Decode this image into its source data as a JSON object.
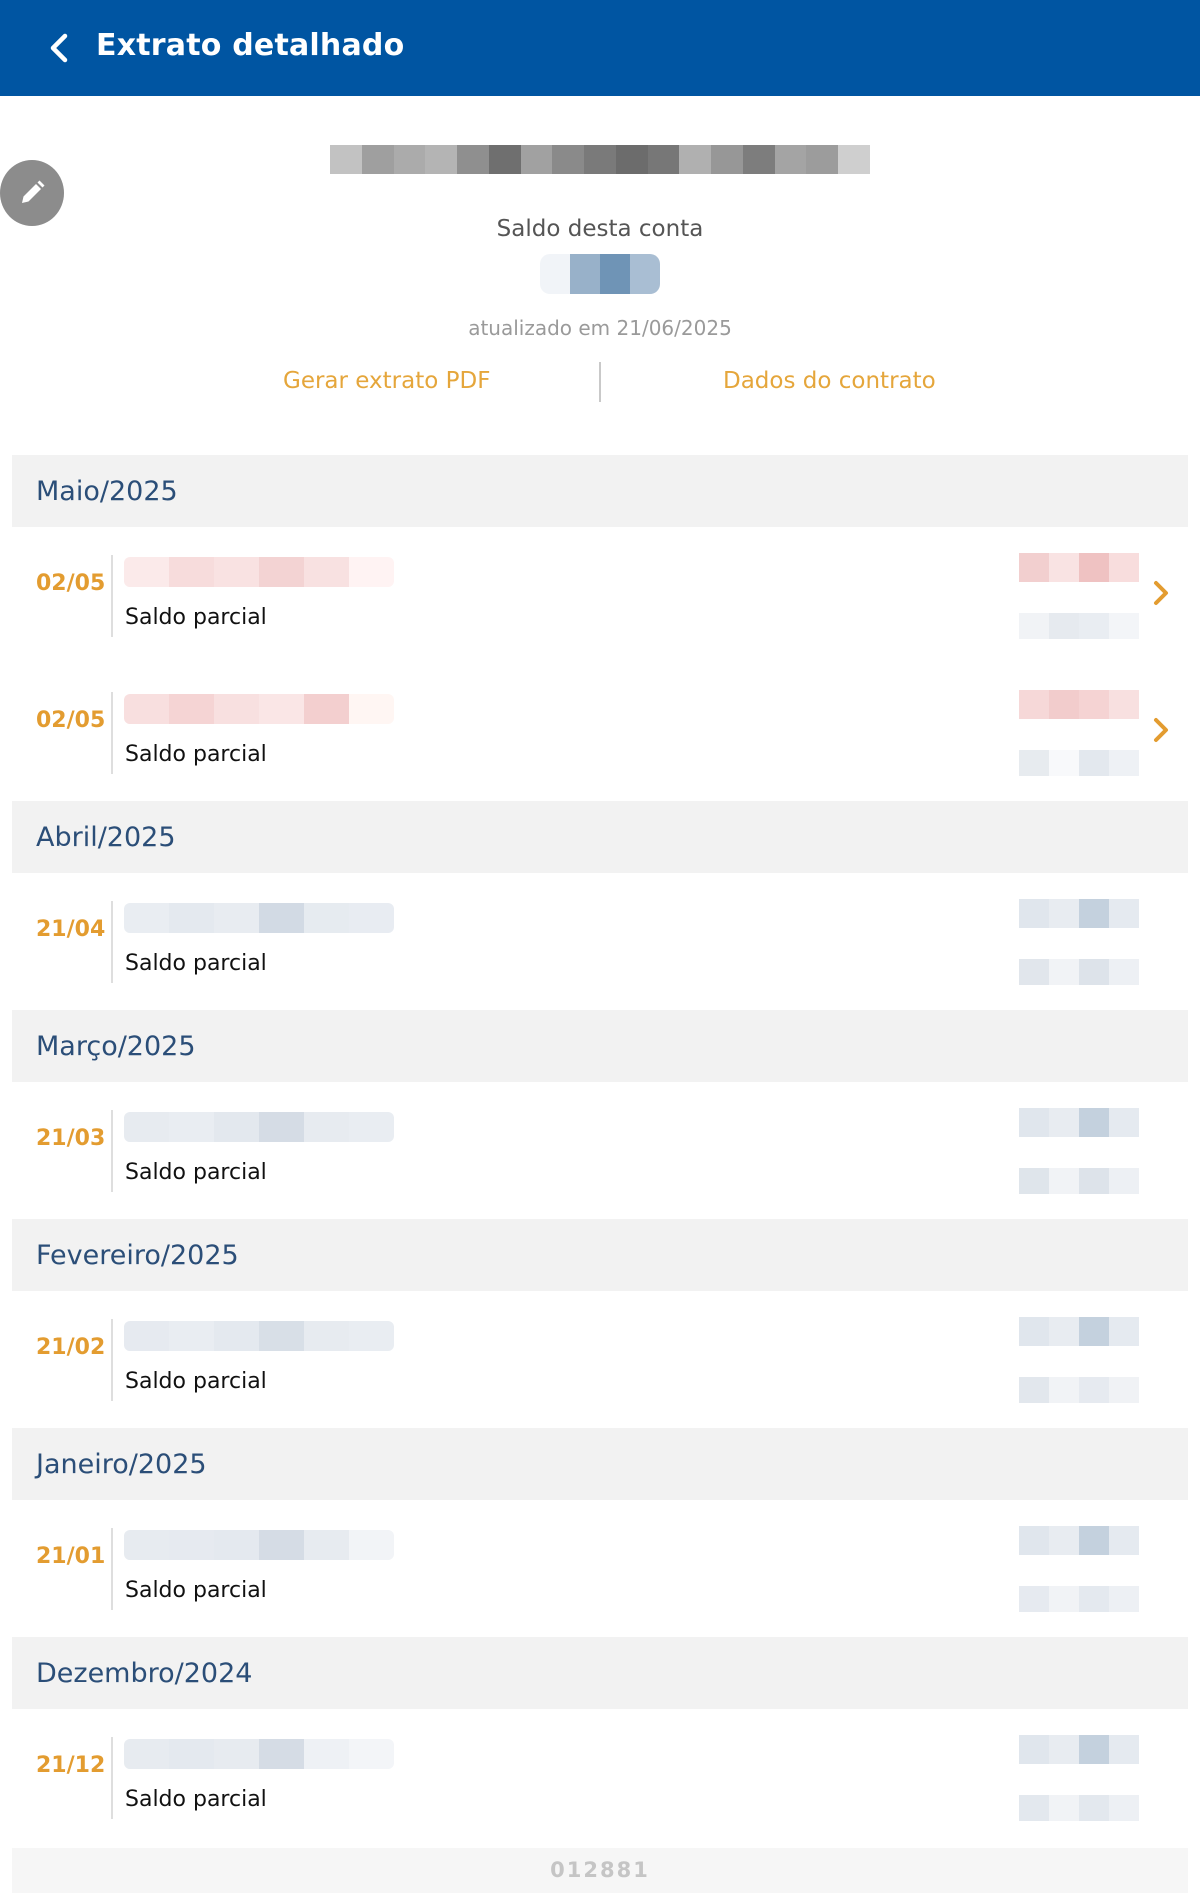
{
  "header": {
    "title": "Extrato detalhado"
  },
  "colors": {
    "brand": "#0055a2",
    "accent": "#e39c30",
    "link": "#e5a63b",
    "month": "#2b4e78"
  },
  "icons": {
    "back": "chevron-left-icon",
    "edit": "pencil-icon",
    "row": "chevron-right-icon"
  },
  "summary": {
    "balance_label": "Saldo desta conta",
    "updated": "atualizado em 21/06/2025"
  },
  "actions": {
    "pdf": "Gerar extrato PDF",
    "contract": "Dados do contrato"
  },
  "groups": [
    {
      "month": "Maio/2025",
      "entries": [
        {
          "date": "02/05",
          "label": "Saldo parcial",
          "tone": "red"
        },
        {
          "date": "02/05",
          "label": "Saldo parcial",
          "tone": "red"
        }
      ]
    },
    {
      "month": "Abril/2025",
      "entries": [
        {
          "date": "21/04",
          "label": "Saldo parcial",
          "tone": "blue"
        }
      ]
    },
    {
      "month": "Março/2025",
      "entries": [
        {
          "date": "21/03",
          "label": "Saldo parcial",
          "tone": "blue"
        }
      ]
    },
    {
      "month": "Fevereiro/2025",
      "entries": [
        {
          "date": "21/02",
          "label": "Saldo parcial",
          "tone": "blue"
        }
      ]
    },
    {
      "month": "Janeiro/2025",
      "entries": [
        {
          "date": "21/01",
          "label": "Saldo parcial",
          "tone": "blue"
        }
      ]
    },
    {
      "month": "Dezembro/2024",
      "entries": [
        {
          "date": "21/12",
          "label": "Saldo parcial",
          "tone": "blue"
        }
      ]
    }
  ],
  "footer": {
    "code": "012881"
  }
}
